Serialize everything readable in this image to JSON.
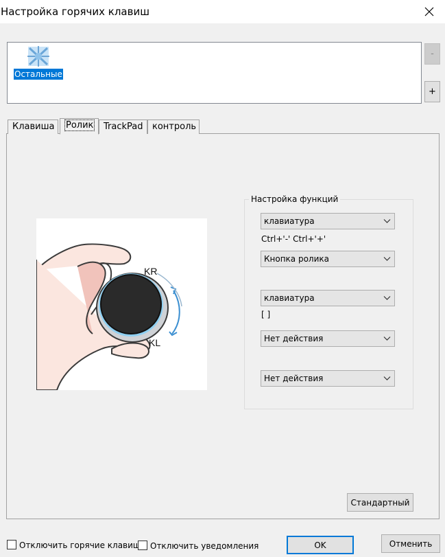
{
  "window": {
    "title": "Настройка горячих клавиш"
  },
  "profiles": {
    "items": [
      {
        "label": "Остальные"
      }
    ],
    "remove_label": "-",
    "add_label": "+"
  },
  "tabs": [
    {
      "label": "Клавиша"
    },
    {
      "label": "Ролик"
    },
    {
      "label": "TrackPad"
    },
    {
      "label": "контроль"
    }
  ],
  "roller_image": {
    "labels": {
      "kr": "KR",
      "kl": "KL"
    }
  },
  "functions": {
    "legend": "Настройка функций",
    "combo1": "клавиатура",
    "note1": "Ctrl+'-'  Ctrl+'+'",
    "combo2": "Кнопка ролика",
    "combo3": "клавиатура",
    "note2": "[  ]",
    "combo4": "Нет действия",
    "combo5": "Нет действия",
    "default_button": "Стандартный"
  },
  "footer": {
    "disable_hotkeys": "Отключить горячие клавиш",
    "disable_notifications": "Отключить уведомления",
    "ok": "OK",
    "cancel": "Отменить"
  }
}
